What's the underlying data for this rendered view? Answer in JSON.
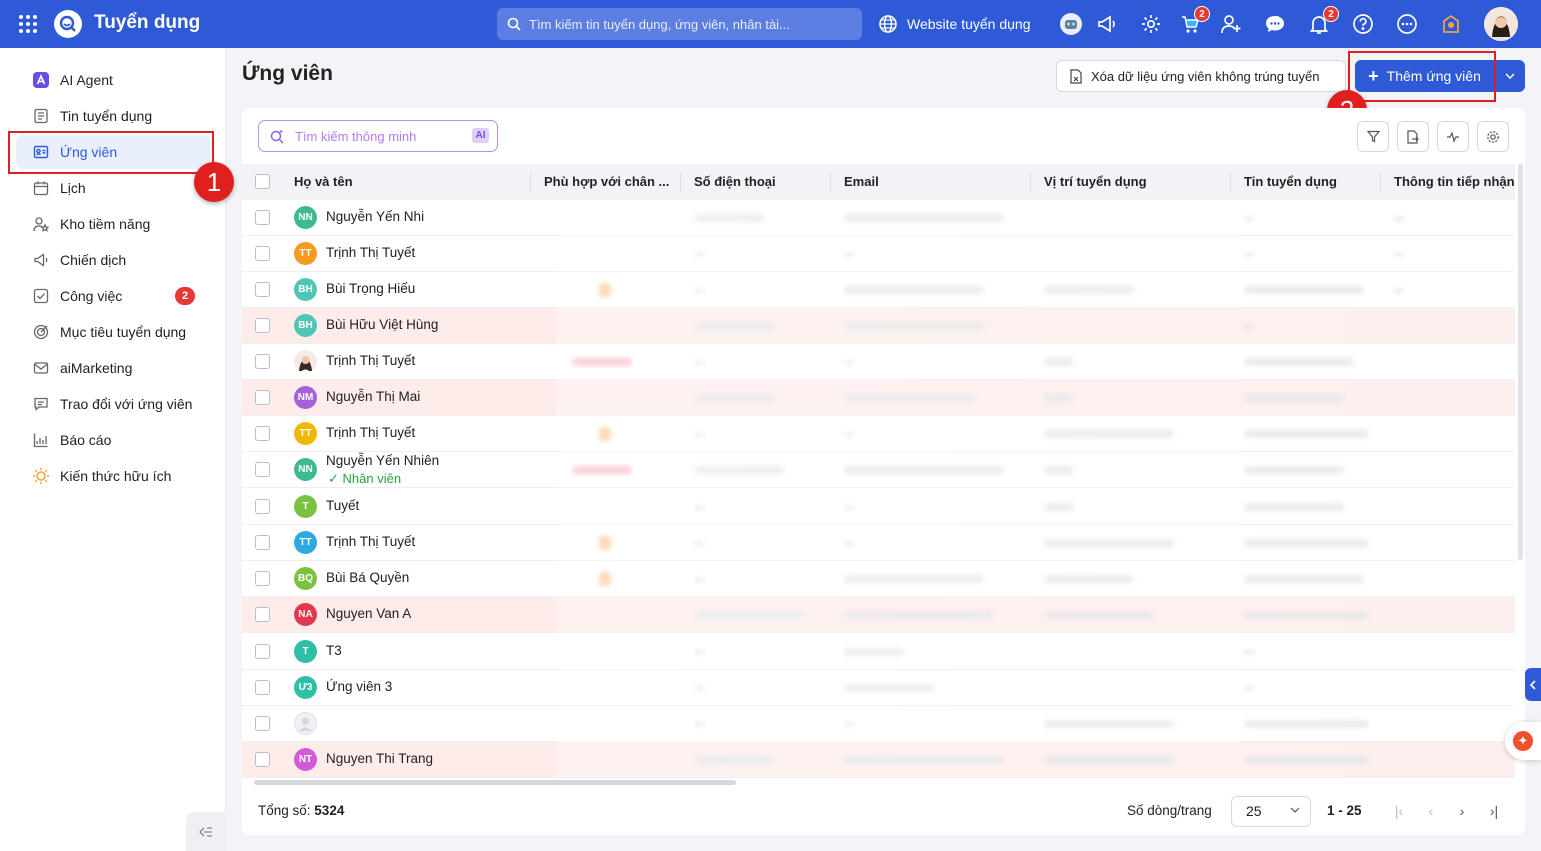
{
  "topbar": {
    "app_title": "Tuyển dụng",
    "search_placeholder": "Tìm kiếm tin tuyển dụng, ứng viên, nhân tài...",
    "website_label": "Website tuyển dụng",
    "cart_badge": "2",
    "notification_badge": "2",
    "accent": "#2e5ad8"
  },
  "sidebar": {
    "items": [
      {
        "label": "AI Agent",
        "icon": "ai-agent-icon"
      },
      {
        "label": "Tin tuyển dụng",
        "icon": "document-icon"
      },
      {
        "label": "Ứng viên",
        "icon": "id-card-icon"
      },
      {
        "label": "Lịch",
        "icon": "calendar-icon"
      },
      {
        "label": "Kho tiềm năng",
        "icon": "users-star-icon"
      },
      {
        "label": "Chiến dịch",
        "icon": "megaphone-icon"
      },
      {
        "label": "Công việc",
        "icon": "check-square-icon",
        "badge": "2"
      },
      {
        "label": "Mục tiêu tuyển dụng",
        "icon": "target-icon"
      },
      {
        "label": "aiMarketing",
        "icon": "mail-icon"
      },
      {
        "label": "Trao đổi với ứng viên",
        "icon": "chat-icon"
      },
      {
        "label": "Báo cáo",
        "icon": "chart-icon"
      },
      {
        "label": "Kiến thức hữu ích",
        "icon": "lightbulb-icon"
      }
    ]
  },
  "annotations": {
    "step1": "1",
    "step2": "2",
    "color": "#e0201f"
  },
  "main": {
    "title": "Ứng viên",
    "delete_button": "Xóa dữ liệu ứng viên không trúng tuyển",
    "add_button": "Thêm ứng viên",
    "smart_search_placeholder": "Tìm kiếm thông minh",
    "ai_chip": "AI"
  },
  "table": {
    "columns": [
      "Họ và tên",
      "Phù hợp với chân ...",
      "Số điện thoại",
      "Email",
      "Vị trí tuyển dụng",
      "Tin tuyển dụng",
      "Thông tin tiếp nhận"
    ],
    "rows": [
      {
        "initials": "NN",
        "name": "Nguyễn Yến Nhi",
        "color": "#3dbb8f",
        "pink": false
      },
      {
        "initials": "TT",
        "name": "Trịnh Thị Tuyết",
        "color": "#f59a23",
        "pink": false
      },
      {
        "initials": "BH",
        "name": "Bùi Trọng Hiếu",
        "color": "#4fc5b5",
        "pink": false
      },
      {
        "initials": "BH",
        "name": "Bùi Hữu Việt Hùng",
        "color": "#4fc5b5",
        "pink": true
      },
      {
        "initials": "",
        "name": "Trịnh Thị Tuyết",
        "color": "photo",
        "pink": false
      },
      {
        "initials": "NM",
        "name": "Nguyễn Thị Mai",
        "color": "#a561d8",
        "pink": true
      },
      {
        "initials": "TT",
        "name": "Trịnh Thị Tuyết",
        "color": "#f2b705",
        "pink": false
      },
      {
        "initials": "NN",
        "name": "Nguyễn Yến Nhiên",
        "color": "#3dbb8f",
        "pink": false,
        "sub": "Nhân viên"
      },
      {
        "initials": "T",
        "name": "Tuyết",
        "color": "#7cc242",
        "pink": false
      },
      {
        "initials": "TT",
        "name": "Trịnh Thị Tuyết",
        "color": "#2fa8e0",
        "pink": false
      },
      {
        "initials": "BQ",
        "name": "Bùi Bá Quyền",
        "color": "#7cc242",
        "pink": false
      },
      {
        "initials": "NA",
        "name": "Nguyen Van A",
        "color": "#e0384e",
        "pink": true
      },
      {
        "initials": "T",
        "name": "T3",
        "color": "#2fbfa6",
        "pink": false
      },
      {
        "initials": "Ư3",
        "name": "Ứng viên 3",
        "color": "#2fbfa6",
        "pink": false
      },
      {
        "initials": "",
        "name": "",
        "color": "placeholder",
        "pink": false
      },
      {
        "initials": "NT",
        "name": "Nguyen Thi Trang",
        "color": "#d35bd8",
        "pink": true
      }
    ]
  },
  "footer": {
    "total_label": "Tổng số:",
    "total_value": "5324",
    "rows_per_page_label": "Số dòng/trang",
    "rows_per_page_value": "25",
    "range": "1 - 25"
  }
}
